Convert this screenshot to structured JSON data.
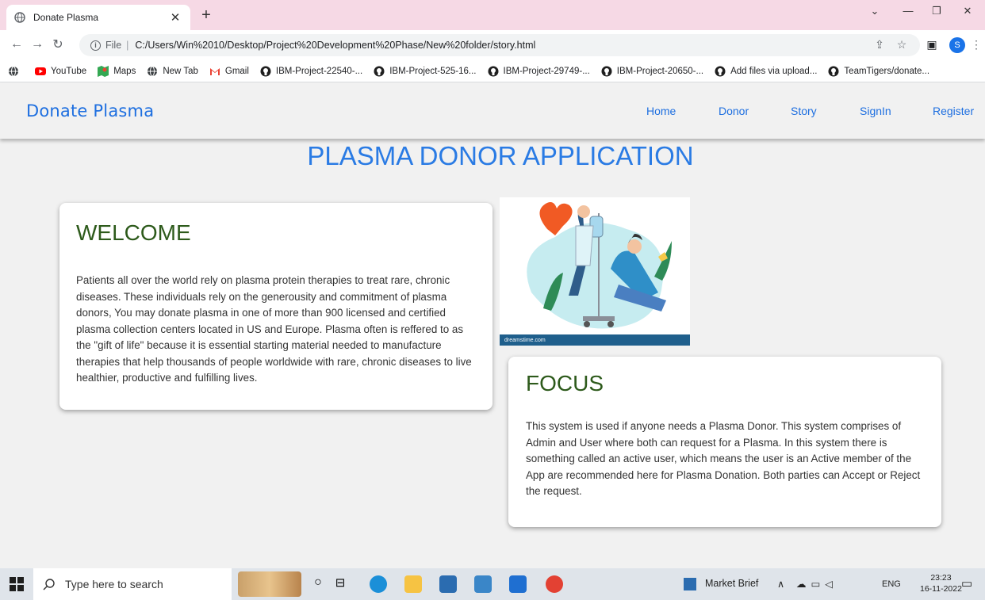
{
  "browser": {
    "tab_title": "Donate Plasma",
    "new_tab_symbol": "+",
    "url_scheme": "File",
    "url": "C:/Users/Win%2010/Desktop/Project%20Development%20Phase/New%20folder/story.html",
    "profile_initial": "S",
    "bookmarks": [
      {
        "icon": "globe-icon",
        "label": ""
      },
      {
        "icon": "youtube-icon",
        "label": "YouTube"
      },
      {
        "icon": "maps-icon",
        "label": "Maps"
      },
      {
        "icon": "globe-icon",
        "label": "New Tab"
      },
      {
        "icon": "gmail-icon",
        "label": "Gmail"
      },
      {
        "icon": "github-icon",
        "label": "IBM-Project-22540-..."
      },
      {
        "icon": "github-icon",
        "label": "IBM-Project-525-16..."
      },
      {
        "icon": "github-icon",
        "label": "IBM-Project-29749-..."
      },
      {
        "icon": "github-icon",
        "label": "IBM-Project-20650-..."
      },
      {
        "icon": "github-icon",
        "label": "Add files via upload..."
      },
      {
        "icon": "github-icon",
        "label": "TeamTigers/donate..."
      }
    ]
  },
  "site": {
    "brand": "Donate Plasma",
    "nav": [
      "Home",
      "Donor",
      "Story",
      "SignIn",
      "Register"
    ],
    "page_title": "PLASMA DONOR APPLICATION",
    "welcome": {
      "heading": "WELCOME",
      "body": "Patients all over the world rely on plasma protein therapies to treat rare, chronic diseases. These individuals rely on the generousity and commitment of plasma donors, You may donate plasma in one of more than 900 licensed and certified plasma collection centers located in US and Europe. Plasma often is reffered to as the \"gift of life\" because it is essential starting material needed to manufacture therapies that help thousands of people worldwide with rare, chronic diseases to live healthier, productive and fulfilling lives."
    },
    "image_watermark": "dreamstime.com",
    "focus": {
      "heading": "FOCUS",
      "body": "This system is used if anyone needs a Plasma Donor. This system comprises of Admin and User where both can request for a Plasma. In this system there is something called an active user, which means the user is an Active member of the App are recommended here for Plasma Donation. Both parties can Accept or Reject the request."
    }
  },
  "taskbar": {
    "search_placeholder": "Type here to search",
    "market_label": "Market Brief",
    "language": "ENG",
    "time": "23:23",
    "date": "16-11-2022"
  },
  "colors": {
    "brand_blue": "#1e6fe0",
    "heading_green": "#2d5a1b",
    "tabstrip_pink": "#f6d9e5"
  }
}
